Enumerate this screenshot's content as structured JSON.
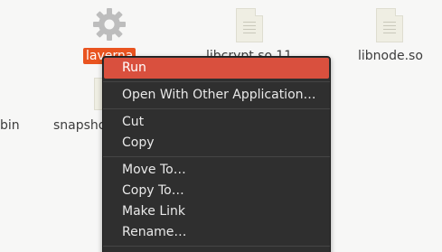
{
  "desktop": {
    "files": [
      {
        "name": "laverna",
        "icon": "gear-icon",
        "selected": true
      },
      {
        "name": "libcrypt.so.11",
        "icon": "text-file-icon"
      },
      {
        "name": "libnode.so",
        "icon": "text-file-icon"
      },
      {
        "name": "bin",
        "icon": "folder-icon"
      },
      {
        "name": "snapsho",
        "icon": "text-file-icon"
      }
    ]
  },
  "context_menu": {
    "items": [
      {
        "label": "Run"
      },
      {
        "label": "Open With Other Application…"
      },
      {
        "label": "Cut"
      },
      {
        "label": "Copy"
      },
      {
        "label": "Move To…"
      },
      {
        "label": "Copy To…"
      },
      {
        "label": "Make Link"
      },
      {
        "label": "Rename…"
      }
    ]
  }
}
